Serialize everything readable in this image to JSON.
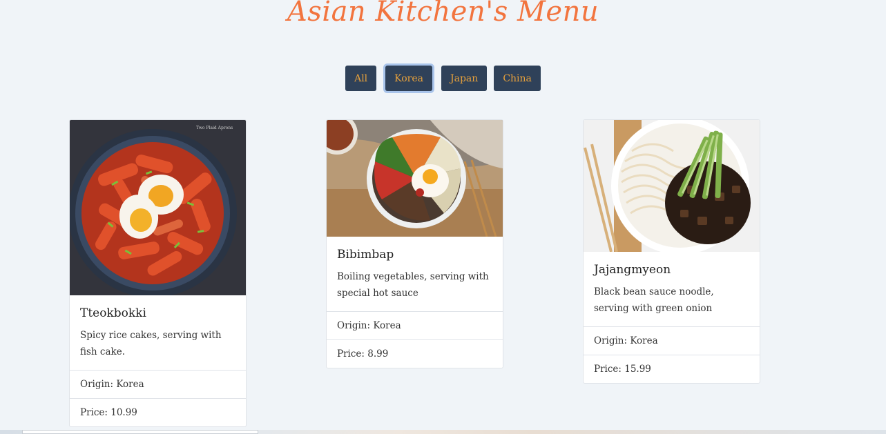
{
  "header": {
    "title": "Asian Kitchen's Menu"
  },
  "filters": [
    {
      "label": "All",
      "active": false
    },
    {
      "label": "Korea",
      "active": true
    },
    {
      "label": "Japan",
      "active": false
    },
    {
      "label": "China",
      "active": false
    }
  ],
  "menu": [
    {
      "title": "Tteokbokki",
      "description": "Spicy rice cakes, serving with fish cake.",
      "origin": "Origin: Korea",
      "price": "Price: 10.99",
      "image_watermark": "Two Plaid Aprons"
    },
    {
      "title": "Bibimbap",
      "description": "Boiling vegetables, serving with special hot sauce",
      "origin": "Origin: Korea",
      "price": "Price: 8.99"
    },
    {
      "title": "Jajangmyeon",
      "description": "Black bean sauce noodle, serving with green onion",
      "origin": "Origin: Korea",
      "price": "Price: 15.99"
    }
  ],
  "colors": {
    "accent": "#f2743e",
    "button_bg": "#2f4159",
    "button_text": "#e9a23b",
    "page_bg": "#f0f4f8"
  }
}
